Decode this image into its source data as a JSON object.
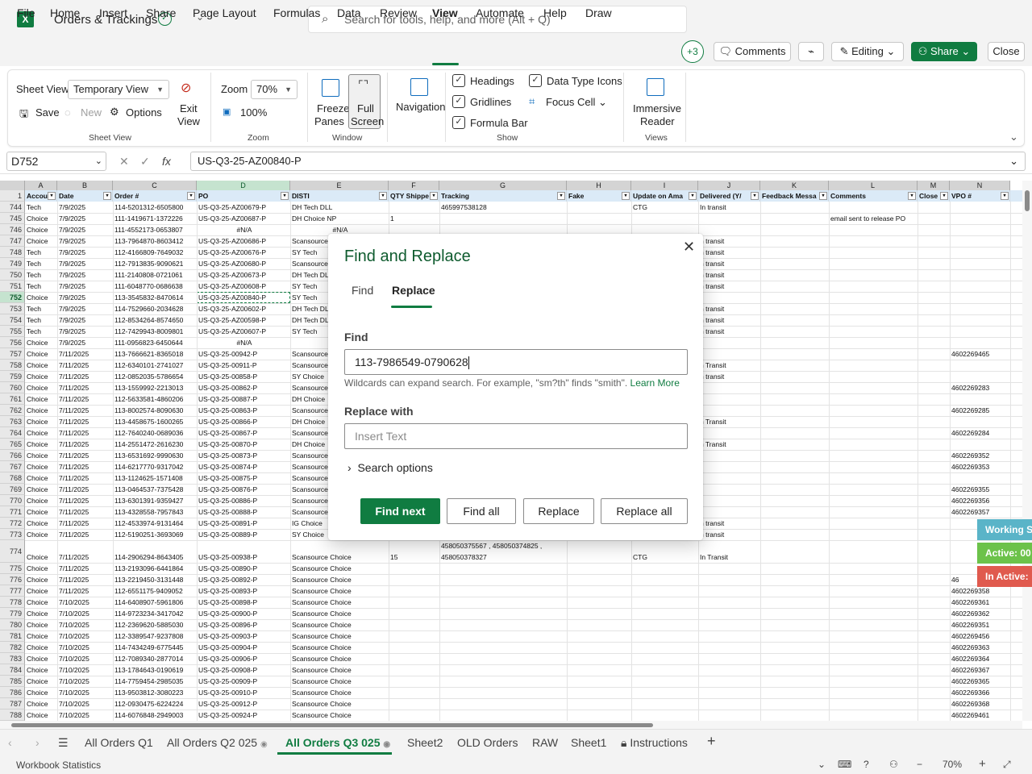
{
  "titlebar": {
    "app_icon": "X",
    "title": "Orders & Trackings",
    "search_placeholder": "Search for tools, help, and more (Alt + Q)"
  },
  "menu": {
    "items": [
      "File",
      "Home",
      "Insert",
      "Share",
      "Page Layout",
      "Formulas",
      "Data",
      "Review",
      "View",
      "Automate",
      "Help",
      "Draw"
    ],
    "active": "View"
  },
  "actions": {
    "collaborators": "+3",
    "comments": "Comments",
    "editing": "Editing",
    "share": "Share",
    "close": "Close"
  },
  "ribbon": {
    "sheet_view_label": "Sheet View",
    "sheet_view_value": "Temporary View",
    "save": "Save",
    "new": "New",
    "options": "Options",
    "exit_view_1": "Exit",
    "exit_view_2": "View",
    "group_sheet_view": "Sheet View",
    "zoom_label": "Zoom",
    "zoom_value": "70%",
    "zoom_100": "100%",
    "group_zoom": "Zoom",
    "freeze_1": "Freeze",
    "freeze_2": "Panes",
    "full_1": "Full",
    "full_2": "Screen",
    "group_window": "Window",
    "navigation": "Navigation",
    "headings": "Headings",
    "gridlines": "Gridlines",
    "formula_bar": "Formula Bar",
    "data_type_icons": "Data Type Icons",
    "focus_cell": "Focus Cell",
    "group_show": "Show",
    "immersive_1": "Immersive",
    "immersive_2": "Reader",
    "group_views": "Views"
  },
  "formula_bar": {
    "cell_ref": "D752",
    "fx": "fx",
    "content": "US-Q3-25-AZ00840-P"
  },
  "sheet": {
    "columns": [
      "A",
      "B",
      "C",
      "D",
      "E",
      "F",
      "G",
      "H",
      "I",
      "J",
      "K",
      "L",
      "M",
      "N"
    ],
    "header_row_num": "1",
    "headers": [
      "Accou",
      "Date",
      "Order #",
      "PO",
      "DISTI",
      "QTY Shippe",
      "Tracking",
      "Fake",
      "Update on Ama",
      "Delivered (Y/",
      "Feedback Messa",
      "Comments",
      "Close",
      "VPO #"
    ],
    "rows": [
      {
        "n": "744",
        "cells": [
          "Tech",
          "7/9/2025",
          "114-5201312-6505800",
          "US-Q3-25-AZ00679-P",
          "DH Tech DLL",
          "",
          "465997538128",
          "",
          "CTG",
          "In transit",
          "",
          "",
          "",
          ""
        ]
      },
      {
        "n": "745",
        "cells": [
          "Choice",
          "7/9/2025",
          "111-1419671-1372226",
          "US-Q3-25-AZ00687-P",
          "DH Choice NP",
          "1",
          "",
          "",
          "",
          "",
          "",
          "email sent to release PO",
          "",
          ""
        ]
      },
      {
        "n": "746",
        "cells": [
          "Choice",
          "7/9/2025",
          "111-4552173-0653807",
          "#N/A",
          "#N/A",
          "",
          "",
          "",
          "",
          "",
          "",
          "",
          "",
          ""
        ]
      },
      {
        "n": "747",
        "cells": [
          "Choice",
          "7/9/2025",
          "113-7964870-8603412",
          "US-Q3-25-AZ00686-P",
          "Scansource",
          "",
          "",
          "",
          "",
          "n transit",
          "",
          "",
          "",
          ""
        ]
      },
      {
        "n": "748",
        "cells": [
          "Tech",
          "7/9/2025",
          "112-4166809-7649032",
          "US-Q3-25-AZ00676-P",
          "SY Tech",
          "",
          "",
          "",
          "",
          "n transit",
          "",
          "",
          "",
          ""
        ]
      },
      {
        "n": "749",
        "cells": [
          "Tech",
          "7/9/2025",
          "112-7913835-9090621",
          "US-Q3-25-AZ00680-P",
          "Scansource",
          "",
          "",
          "",
          "",
          "n transit",
          "",
          "",
          "",
          ""
        ]
      },
      {
        "n": "750",
        "cells": [
          "Tech",
          "7/9/2025",
          "111-2140808-0721061",
          "US-Q3-25-AZ00673-P",
          "DH Tech DL",
          "",
          "",
          "",
          "",
          "n transit",
          "",
          "",
          "",
          ""
        ]
      },
      {
        "n": "751",
        "cells": [
          "Tech",
          "7/9/2025",
          "111-6048770-0686638",
          "US-Q3-25-AZ00608-P",
          "SY Tech",
          "",
          "",
          "",
          "",
          "n transit",
          "",
          "",
          "",
          ""
        ]
      },
      {
        "n": "752",
        "cells": [
          "Choice",
          "7/9/2025",
          "113-3545832-8470614",
          "US-Q3-25-AZ00840-P",
          "SY Tech",
          "",
          "",
          "",
          "",
          "",
          "",
          "",
          "",
          ""
        ]
      },
      {
        "n": "753",
        "cells": [
          "Tech",
          "7/9/2025",
          "114-7529660-2034628",
          "US-Q3-25-AZ00602-P",
          "DH Tech DL",
          "",
          "",
          "",
          "",
          "n transit",
          "",
          "",
          "",
          ""
        ]
      },
      {
        "n": "754",
        "cells": [
          "Tech",
          "7/9/2025",
          "112-8534264-8574650",
          "US-Q3-25-AZ00598-P",
          "DH Tech DL",
          "",
          "",
          "",
          "",
          "n transit",
          "",
          "",
          "",
          ""
        ]
      },
      {
        "n": "755",
        "cells": [
          "Tech",
          "7/9/2025",
          "112-7429943-8009801",
          "US-Q3-25-AZ00607-P",
          "SY Tech",
          "",
          "",
          "",
          "",
          "n transit",
          "",
          "",
          "",
          ""
        ]
      },
      {
        "n": "756",
        "cells": [
          "Choice",
          "7/9/2025",
          "111-0956823-6450644",
          "#N/A",
          "",
          "",
          "",
          "",
          "",
          "",
          "",
          "",
          "",
          ""
        ]
      },
      {
        "n": "757",
        "cells": [
          "Choice",
          "7/11/2025",
          "113-7666621-8365018",
          "US-Q3-25-00942-P",
          "Scansource",
          "",
          "",
          "",
          "",
          "",
          "",
          "",
          "",
          "4602269465"
        ]
      },
      {
        "n": "758",
        "cells": [
          "Choice",
          "7/11/2025",
          "112-6340101-2741027",
          "US-Q3-25-00911-P",
          "Scansource",
          "",
          "",
          "",
          "",
          "n Transit",
          "",
          "",
          "",
          ""
        ]
      },
      {
        "n": "759",
        "cells": [
          "Choice",
          "7/11/2025",
          "112-0852035-5786654",
          "US-Q3-25-00858-P",
          "SY Choice",
          "",
          "",
          "",
          "",
          "n transit",
          "",
          "",
          "",
          ""
        ]
      },
      {
        "n": "760",
        "cells": [
          "Choice",
          "7/11/2025",
          "113-1559992-2213013",
          "US-Q3-25-00862-P",
          "Scansource",
          "",
          "",
          "",
          "",
          "",
          "",
          "",
          "",
          "4602269283"
        ]
      },
      {
        "n": "761",
        "cells": [
          "Choice",
          "7/11/2025",
          "112-5633581-4860206",
          "US-Q3-25-00887-P",
          "DH Choice",
          "",
          "",
          "",
          "",
          "",
          "",
          "",
          "",
          ""
        ]
      },
      {
        "n": "762",
        "cells": [
          "Choice",
          "7/11/2025",
          "113-8002574-8090630",
          "US-Q3-25-00863-P",
          "Scansource",
          "",
          "",
          "",
          "",
          "",
          "",
          "",
          "",
          "4602269285"
        ]
      },
      {
        "n": "763",
        "cells": [
          "Choice",
          "7/11/2025",
          "113-4458675-1600265",
          "US-Q3-25-00866-P",
          "DH Choice",
          "",
          "",
          "",
          "",
          "n Transit",
          "",
          "",
          "",
          ""
        ]
      },
      {
        "n": "764",
        "cells": [
          "Choice",
          "7/11/2025",
          "112-7640240-0689036",
          "US-Q3-25-00867-P",
          "Scansource",
          "",
          "",
          "",
          "",
          "",
          "",
          "",
          "",
          "4602269284"
        ]
      },
      {
        "n": "765",
        "cells": [
          "Choice",
          "7/11/2025",
          "114-2551472-2616230",
          "US-Q3-25-00870-P",
          "DH Choice",
          "",
          "",
          "",
          "",
          "n Transit",
          "",
          "",
          "",
          ""
        ]
      },
      {
        "n": "766",
        "cells": [
          "Choice",
          "7/11/2025",
          "113-6531692-9990630",
          "US-Q3-25-00873-P",
          "Scansource",
          "",
          "",
          "",
          "",
          "",
          "",
          "",
          "",
          "4602269352"
        ]
      },
      {
        "n": "767",
        "cells": [
          "Choice",
          "7/11/2025",
          "114-6217770-9317042",
          "US-Q3-25-00874-P",
          "Scansource",
          "",
          "",
          "",
          "",
          "",
          "",
          "",
          "",
          "4602269353"
        ]
      },
      {
        "n": "768",
        "cells": [
          "Choice",
          "7/11/2025",
          "113-1124625-1571408",
          "US-Q3-25-00875-P",
          "Scansource",
          "",
          "",
          "",
          "",
          "",
          "",
          "",
          "",
          ""
        ]
      },
      {
        "n": "769",
        "cells": [
          "Choice",
          "7/11/2025",
          "113-0464537-7375428",
          "US-Q3-25-00876-P",
          "Scansource",
          "",
          "",
          "",
          "",
          "",
          "",
          "",
          "",
          "4602269355"
        ]
      },
      {
        "n": "770",
        "cells": [
          "Choice",
          "7/11/2025",
          "113-6301391-9359427",
          "US-Q3-25-00886-P",
          "Scansource",
          "",
          "",
          "",
          "",
          "",
          "",
          "",
          "",
          "4602269356"
        ]
      },
      {
        "n": "771",
        "cells": [
          "Choice",
          "7/11/2025",
          "113-4328558-7957843",
          "US-Q3-25-00888-P",
          "Scansource",
          "",
          "",
          "",
          "",
          "",
          "",
          "",
          "",
          "4602269357"
        ]
      },
      {
        "n": "772",
        "cells": [
          "Choice",
          "7/11/2025",
          "112-4533974-9131464",
          "US-Q3-25-00891-P",
          "IG Choice",
          "",
          "",
          "",
          "",
          "n transit",
          "",
          "",
          "",
          ""
        ]
      },
      {
        "n": "773",
        "cells": [
          "Choice",
          "7/11/2025",
          "112-5190251-3693069",
          "US-Q3-25-00889-P",
          "SY Choice",
          "",
          "",
          "",
          "",
          "n transit",
          "",
          "",
          "",
          ""
        ]
      },
      {
        "n": "774",
        "cells": [
          "Choice",
          "7/11/2025",
          "114-2906294-8643405",
          "US-Q3-25-00938-P",
          "Scansource Choice",
          "15",
          "458050375567 , 458050374825 , 458050378327",
          "",
          "CTG",
          "In Transit",
          "",
          "",
          "",
          ""
        ]
      },
      {
        "n": "775",
        "cells": [
          "Choice",
          "7/11/2025",
          "113-2193096-6441864",
          "US-Q3-25-00890-P",
          "Scansource Choice",
          "",
          "",
          "",
          "",
          "",
          "",
          "",
          "",
          ""
        ]
      },
      {
        "n": "776",
        "cells": [
          "Choice",
          "7/11/2025",
          "113-2219450-3131448",
          "US-Q3-25-00892-P",
          "Scansource Choice",
          "",
          "",
          "",
          "",
          "",
          "",
          "",
          "",
          "46"
        ]
      },
      {
        "n": "777",
        "cells": [
          "Choice",
          "7/11/2025",
          "112-6551175-9409052",
          "US-Q3-25-00893-P",
          "Scansource Choice",
          "",
          "",
          "",
          "",
          "",
          "",
          "",
          "",
          "4602269358"
        ]
      },
      {
        "n": "778",
        "cells": [
          "Choice",
          "7/10/2025",
          "114-6408907-5961806",
          "US-Q3-25-00898-P",
          "Scansource Choice",
          "",
          "",
          "",
          "",
          "",
          "",
          "",
          "",
          "4602269361"
        ]
      },
      {
        "n": "779",
        "cells": [
          "Choice",
          "7/10/2025",
          "114-9723234-3417042",
          "US-Q3-25-00900-P",
          "Scansource Choice",
          "",
          "",
          "",
          "",
          "",
          "",
          "",
          "",
          "4602269362"
        ]
      },
      {
        "n": "780",
        "cells": [
          "Choice",
          "7/10/2025",
          "112-2369620-5885030",
          "US-Q3-25-00896-P",
          "Scansource Choice",
          "",
          "",
          "",
          "",
          "",
          "",
          "",
          "",
          "4602269351"
        ]
      },
      {
        "n": "781",
        "cells": [
          "Choice",
          "7/10/2025",
          "112-3389547-9237808",
          "US-Q3-25-00903-P",
          "Scansource Choice",
          "",
          "",
          "",
          "",
          "",
          "",
          "",
          "",
          "4602269456"
        ]
      },
      {
        "n": "782",
        "cells": [
          "Choice",
          "7/10/2025",
          "114-7434249-6775445",
          "US-Q3-25-00904-P",
          "Scansource Choice",
          "",
          "",
          "",
          "",
          "",
          "",
          "",
          "",
          "4602269363"
        ]
      },
      {
        "n": "783",
        "cells": [
          "Choice",
          "7/10/2025",
          "112-7089340-2877014",
          "US-Q3-25-00906-P",
          "Scansource Choice",
          "",
          "",
          "",
          "",
          "",
          "",
          "",
          "",
          "4602269364"
        ]
      },
      {
        "n": "784",
        "cells": [
          "Choice",
          "7/10/2025",
          "113-1784643-0190619",
          "US-Q3-25-00908-P",
          "Scansource Choice",
          "",
          "",
          "",
          "",
          "",
          "",
          "",
          "",
          "4602269367"
        ]
      },
      {
        "n": "785",
        "cells": [
          "Choice",
          "7/10/2025",
          "114-7759454-2985035",
          "US-Q3-25-00909-P",
          "Scansource Choice",
          "",
          "",
          "",
          "",
          "",
          "",
          "",
          "",
          "4602269365"
        ]
      },
      {
        "n": "786",
        "cells": [
          "Choice",
          "7/10/2025",
          "113-9503812-3080223",
          "US-Q3-25-00910-P",
          "Scansource Choice",
          "",
          "",
          "",
          "",
          "",
          "",
          "",
          "",
          "4602269366"
        ]
      },
      {
        "n": "787",
        "cells": [
          "Choice",
          "7/10/2025",
          "112-0930475-6224224",
          "US-Q3-25-00912-P",
          "Scansource Choice",
          "",
          "",
          "",
          "",
          "",
          "",
          "",
          "",
          "4602269368"
        ]
      },
      {
        "n": "788",
        "cells": [
          "Choice",
          "7/10/2025",
          "114-6076848-2949003",
          "US-Q3-25-00924-P",
          "Scansource Choice",
          "",
          "",
          "",
          "",
          "",
          "",
          "",
          "",
          "4602269461"
        ]
      }
    ]
  },
  "overlay": {
    "working": "Working S",
    "active": "Active: 00",
    "inactive": "In Active: "
  },
  "dialog": {
    "title": "Find and Replace",
    "tab_find": "Find",
    "tab_replace": "Replace",
    "find_label": "Find",
    "find_value": "113-7986549-0790628",
    "hint": "Wildcards can expand search. For example, \"sm?th\" finds \"smith\".",
    "learn_more": "Learn More",
    "replace_label": "Replace with",
    "replace_placeholder": "Insert Text",
    "search_options": "Search options",
    "btn_find_next": "Find next",
    "btn_find_all": "Find all",
    "btn_replace": "Replace",
    "btn_replace_all": "Replace all"
  },
  "tabs": {
    "items": [
      "All Orders Q1",
      "All Orders Q2 025",
      "All Orders Q3 025",
      "Sheet2",
      "OLD Orders",
      "RAW",
      "Sheet1",
      "Instructions"
    ],
    "active": "All Orders Q3 025"
  },
  "status": {
    "workbook_statistics": "Workbook Statistics",
    "zoom": "70%"
  },
  "colors": {
    "accent": "#107c41",
    "working": "#5ab4c8",
    "active": "#6cc24a",
    "inactive": "#e05a4e"
  }
}
